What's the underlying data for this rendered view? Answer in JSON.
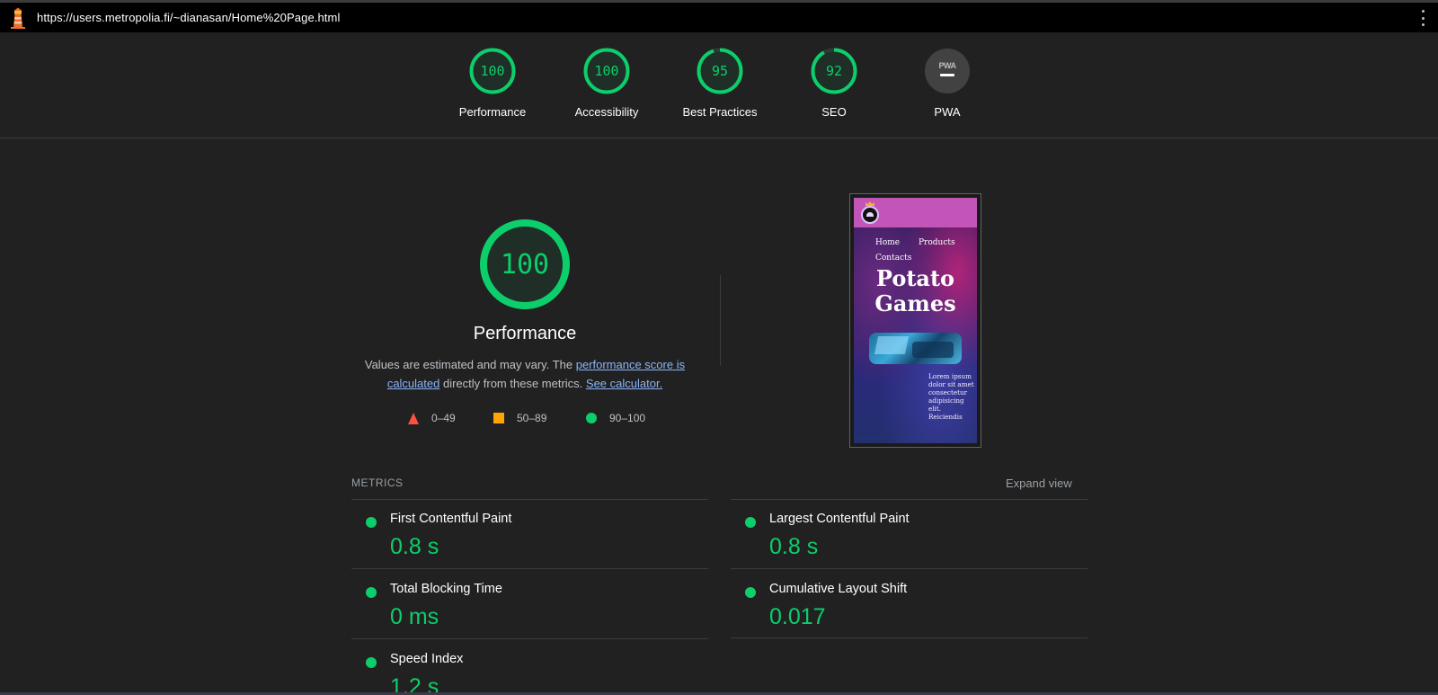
{
  "browser": {
    "url": "https://users.metropolia.fi/~dianasan/Home%20Page.html"
  },
  "colors": {
    "pass": "#0cce6b",
    "average": "#ffa400",
    "fail": "#ff4e42",
    "link": "#8ab4f8"
  },
  "categories": [
    {
      "name": "Performance",
      "score": "100",
      "value": 1.0
    },
    {
      "name": "Accessibility",
      "score": "100",
      "value": 1.0
    },
    {
      "name": "Best Practices",
      "score": "95",
      "value": 0.95
    },
    {
      "name": "SEO",
      "score": "92",
      "value": 0.92
    },
    {
      "name": "PWA",
      "badge_text": "PWA"
    }
  ],
  "performance": {
    "score": "100",
    "value": 1.0,
    "title": "Performance",
    "desc_prefix": "Values are estimated and may vary. The ",
    "desc_link1": "performance score is calculated",
    "desc_middle": " directly from these metrics. ",
    "desc_link2": "See calculator."
  },
  "legend": {
    "fail": "0–49",
    "average": "50–89",
    "pass": "90–100"
  },
  "screenshot": {
    "nav_home": "Home",
    "nav_products": "Products",
    "nav_contacts": "Contacts",
    "title_line1": "Potato",
    "title_line2": "Games",
    "lorem": "Lorem ipsum dolor sit amet consectetur adipisicing elit. Reiciendis"
  },
  "metrics": {
    "label": "METRICS",
    "expand": "Expand view",
    "items": [
      {
        "name": "First Contentful Paint",
        "value": "0.8 s"
      },
      {
        "name": "Largest Contentful Paint",
        "value": "0.8 s"
      },
      {
        "name": "Total Blocking Time",
        "value": "0 ms"
      },
      {
        "name": "Cumulative Layout Shift",
        "value": "0.017"
      },
      {
        "name": "Speed Index",
        "value": "1.2 s"
      }
    ]
  }
}
